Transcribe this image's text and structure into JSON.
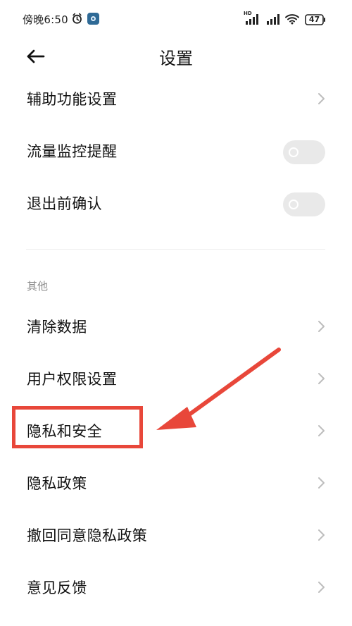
{
  "status_bar": {
    "time": "傍晚6:50",
    "battery": "47",
    "network_badge": "HD"
  },
  "header": {
    "title": "设置"
  },
  "settings": {
    "rows": [
      {
        "label": "辅助功能设置",
        "kind": "link"
      },
      {
        "label": "流量监控提醒",
        "kind": "toggle",
        "enabled": false
      },
      {
        "label": "退出前确认",
        "kind": "toggle",
        "enabled": false
      }
    ]
  },
  "others": {
    "section_title": "其他",
    "rows": [
      {
        "label": "清除数据",
        "kind": "link"
      },
      {
        "label": "用户权限设置",
        "kind": "link"
      },
      {
        "label": "隐私和安全",
        "kind": "link",
        "highlighted": true
      },
      {
        "label": "隐私政策",
        "kind": "link"
      },
      {
        "label": "撤回同意隐私政策",
        "kind": "link"
      },
      {
        "label": "意见反馈",
        "kind": "link"
      }
    ]
  },
  "colors": {
    "accent": "#e8473a",
    "toggle_off_bg": "#e9e9e9",
    "chevron": "#bdbdbd",
    "section_text": "#8a8a8a",
    "text": "#111111"
  },
  "icons": [
    "alarm-icon",
    "app-badge-icon",
    "signal-icon",
    "wifi-icon",
    "battery-icon",
    "back-arrow-icon",
    "chevron-right-icon"
  ]
}
